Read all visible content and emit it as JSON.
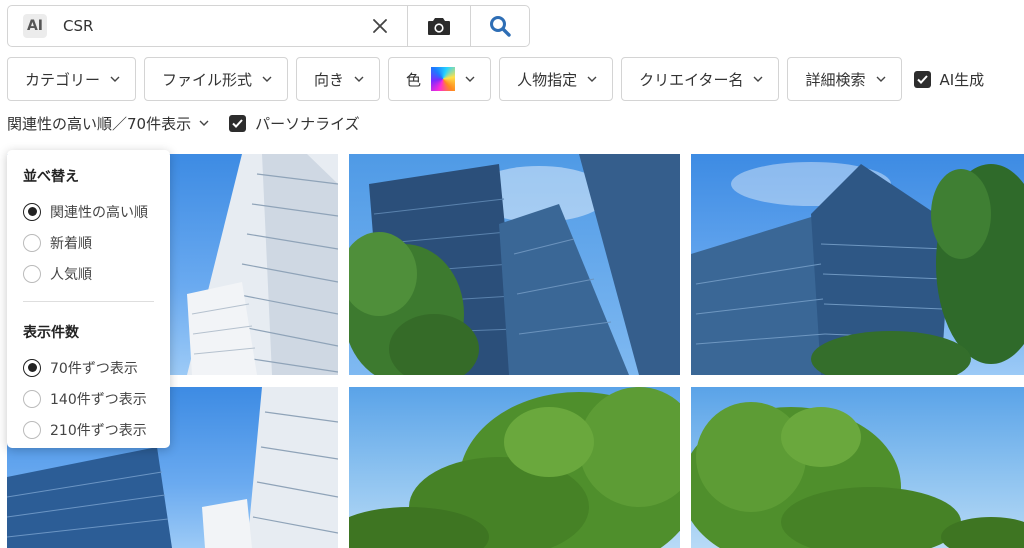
{
  "search": {
    "ai_badge": "AI",
    "query": "CSR",
    "icons": {
      "clear": "close-icon",
      "camera": "camera-icon",
      "search": "search-icon"
    },
    "search_icon_color": "#2e6eb5"
  },
  "filters": [
    {
      "label": "カテゴリー"
    },
    {
      "label": "ファイル形式"
    },
    {
      "label": "向き"
    },
    {
      "label": "色"
    },
    {
      "label": "人物指定"
    },
    {
      "label": "クリエイター名"
    },
    {
      "label": "詳細検索"
    }
  ],
  "ai_generated": {
    "label": "AI生成",
    "checked": true
  },
  "sort_bar": {
    "label": "関連性の高い順／70件表示",
    "personalize_label": "パーソナライズ",
    "personalize_checked": true
  },
  "sort_panel": {
    "sort_heading": "並べ替え",
    "sort_options": [
      {
        "label": "関連性の高い順",
        "selected": true
      },
      {
        "label": "新着順",
        "selected": false
      },
      {
        "label": "人気順",
        "selected": false
      }
    ],
    "count_heading": "表示件数",
    "count_options": [
      {
        "label": "70件ずつ表示",
        "selected": true
      },
      {
        "label": "140件ずつ表示",
        "selected": false
      },
      {
        "label": "210件ずつ表示",
        "selected": false
      }
    ]
  },
  "thumbnails": [
    {
      "subject": "office-tower-looking-up"
    },
    {
      "subject": "glass-skyscrapers-with-tree"
    },
    {
      "subject": "glass-skyscraper-with-tree"
    },
    {
      "subject": "office-tower-looking-up"
    },
    {
      "subject": "green-trees-blue-sky"
    },
    {
      "subject": "green-trees-blue-sky"
    }
  ],
  "colors": {
    "accent": "#2e6eb5",
    "checkbox": "#2d2d2d",
    "border": "#d4d4d4"
  }
}
